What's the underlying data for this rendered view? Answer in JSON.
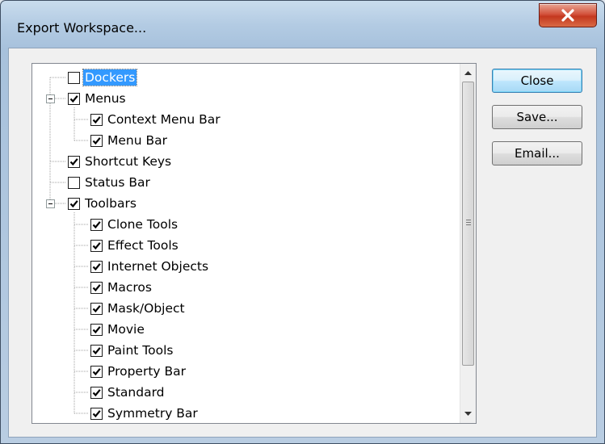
{
  "window": {
    "title": "Export Workspace...",
    "close_icon": "close-x-icon"
  },
  "tree": {
    "items": [
      {
        "label": "Dockers",
        "checked": false,
        "level": 0,
        "selected": true
      },
      {
        "label": "Menus",
        "checked": true,
        "level": 0,
        "expanded": true
      },
      {
        "label": "Context Menu Bar",
        "checked": true,
        "level": 1
      },
      {
        "label": "Menu Bar",
        "checked": true,
        "level": 1
      },
      {
        "label": "Shortcut Keys",
        "checked": true,
        "level": 0
      },
      {
        "label": "Status Bar",
        "checked": false,
        "level": 0
      },
      {
        "label": "Toolbars",
        "checked": true,
        "level": 0,
        "expanded": true
      },
      {
        "label": "Clone Tools",
        "checked": true,
        "level": 1
      },
      {
        "label": "Effect Tools",
        "checked": true,
        "level": 1
      },
      {
        "label": "Internet Objects",
        "checked": true,
        "level": 1
      },
      {
        "label": "Macros",
        "checked": true,
        "level": 1
      },
      {
        "label": "Mask/Object",
        "checked": true,
        "level": 1
      },
      {
        "label": "Movie",
        "checked": true,
        "level": 1
      },
      {
        "label": "Paint Tools",
        "checked": true,
        "level": 1
      },
      {
        "label": "Property Bar",
        "checked": true,
        "level": 1
      },
      {
        "label": "Standard",
        "checked": true,
        "level": 1
      },
      {
        "label": "Symmetry Bar",
        "checked": true,
        "level": 1
      }
    ]
  },
  "buttons": {
    "close_label": "Close",
    "save_label": "Save...",
    "email_label": "Email..."
  },
  "colors": {
    "selection": "#3399ff",
    "close_button": "#c4371f"
  }
}
